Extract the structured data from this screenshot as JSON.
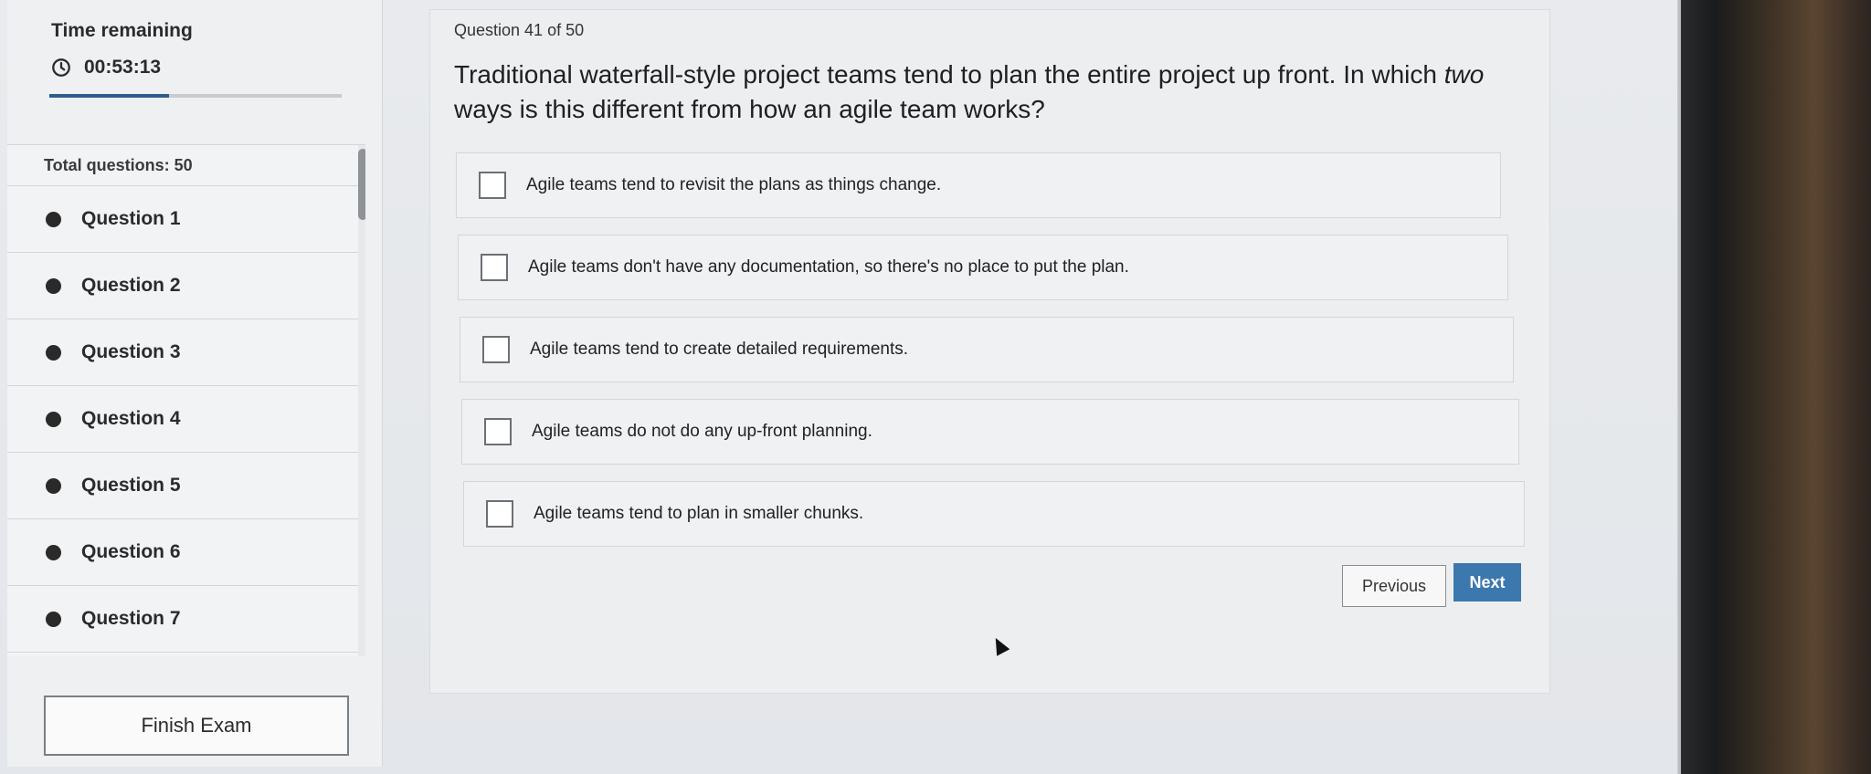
{
  "timer": {
    "label": "Time remaining",
    "value": "00:53:13",
    "progress": 0.41
  },
  "sidebar": {
    "total_label": "Total questions: 50",
    "questions": [
      "Question 1",
      "Question 2",
      "Question 3",
      "Question 4",
      "Question 5",
      "Question 6",
      "Question 7"
    ],
    "finish_label": "Finish Exam"
  },
  "question": {
    "number_label": "Question 41 of 50",
    "text_before": "Traditional waterfall-style project teams tend to plan the entire project up front. In which ",
    "text_emph": "two",
    "text_after": " ways is this different from how an agile team works?",
    "options": [
      "Agile teams tend to revisit the plans as things change.",
      "Agile teams don't have any documentation, so there's no place to put the plan.",
      "Agile teams tend to create detailed requirements.",
      "Agile teams do not do any up-front planning.",
      "Agile teams tend to plan in smaller chunks."
    ]
  },
  "nav": {
    "previous_label": "Previous",
    "next_label": "Next"
  },
  "colors": {
    "accent": "#3c78ae",
    "timer_bar": "#2d5d8c"
  }
}
